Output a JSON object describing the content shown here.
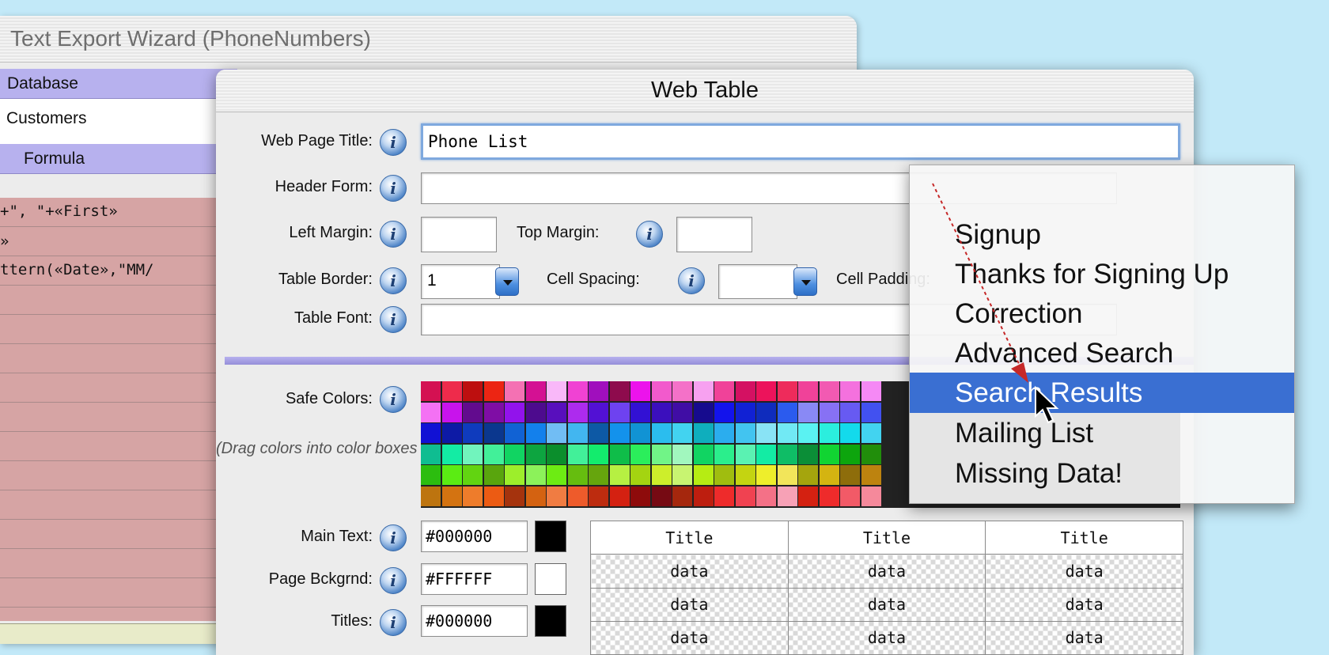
{
  "background_window": {
    "title": "Text Export Wizard (PhoneNumbers)",
    "database_header": "Database",
    "database_value": "Customers",
    "formula_header": "Formula",
    "formula_lines": [
      "+\", \"+«First»",
      "»",
      "ttern(«Date»,\"MM/"
    ]
  },
  "web_table": {
    "title": "Web Table",
    "info_glyph": "i",
    "web_page_title_label": "Web Page Title:",
    "web_page_title_value": "Phone List",
    "header_form_label": "Header Form:",
    "left_margin_label": "Left Margin:",
    "top_margin_label": "Top Margin:",
    "table_border_label": "Table Border:",
    "table_border_value": "1",
    "cell_spacing_label": "Cell Spacing:",
    "cell_padding_label": "Cell Padding:",
    "table_font_label": "Table Font:",
    "safe_colors_label": "Safe Colors:",
    "drag_hint": "(Drag colors into color boxes below)",
    "main_text_label": "Main Text:",
    "main_text_value": "#000000",
    "main_text_color": "#000000",
    "page_bg_label": "Page Bckgrnd:",
    "page_bg_value": "#FFFFFF",
    "page_bg_color": "#FFFFFF",
    "titles_label": "Titles:",
    "titles_value": "#000000",
    "titles_color": "#000000",
    "preview": {
      "headers": [
        "Title",
        "Title",
        "Title"
      ],
      "rows": [
        [
          "data",
          "data",
          "data"
        ],
        [
          "data",
          "data",
          "data"
        ],
        [
          "data",
          "data",
          "data"
        ]
      ]
    }
  },
  "popup_menu": {
    "items": [
      "Signup",
      "Thanks for Signing Up",
      "Correction",
      "Advanced Search",
      "Search Results",
      "Mailing List",
      "Missing Data!"
    ],
    "selected": "Search Results"
  },
  "colors": {
    "menu_highlight": "#3a6fd2",
    "separator": "#b7b1ee",
    "formula_bg": "#d6a4a4",
    "desktop": "#c2e9f8"
  }
}
